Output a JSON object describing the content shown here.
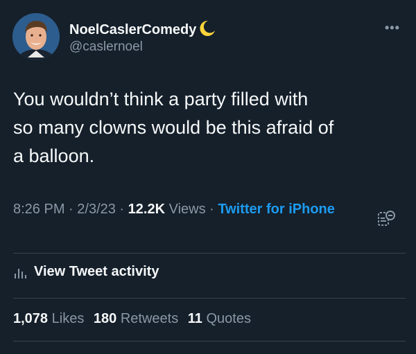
{
  "user": {
    "display_name": "NoelCaslerComedy",
    "handle": "@caslernoel",
    "badge_icon": "crescent-moon-icon"
  },
  "tweet": {
    "text_lines": [
      "You wouldn’t think a party filled with",
      "so many clowns would be this afraid of",
      "a balloon."
    ]
  },
  "meta": {
    "time": "8:26 PM",
    "sep1": " · ",
    "date": "2/3/23",
    "sep2": " · ",
    "views_count": "12.2K",
    "views_label": " Views",
    "sep3": " · ",
    "source": "Twitter for iPhone"
  },
  "activity": {
    "label": "View Tweet activity",
    "icon": "bar-chart-icon"
  },
  "stats": {
    "likes_count": "1,078",
    "likes_label": "Likes",
    "retweets_count": "180",
    "retweets_label": "Retweets",
    "quotes_count": "11",
    "quotes_label": "Quotes"
  },
  "colors": {
    "background": "#15202b",
    "text": "#f7f9f9",
    "muted": "#8b98a5",
    "link": "#1d9bf0",
    "divider": "#38444d",
    "moon": "#ffd43b"
  }
}
